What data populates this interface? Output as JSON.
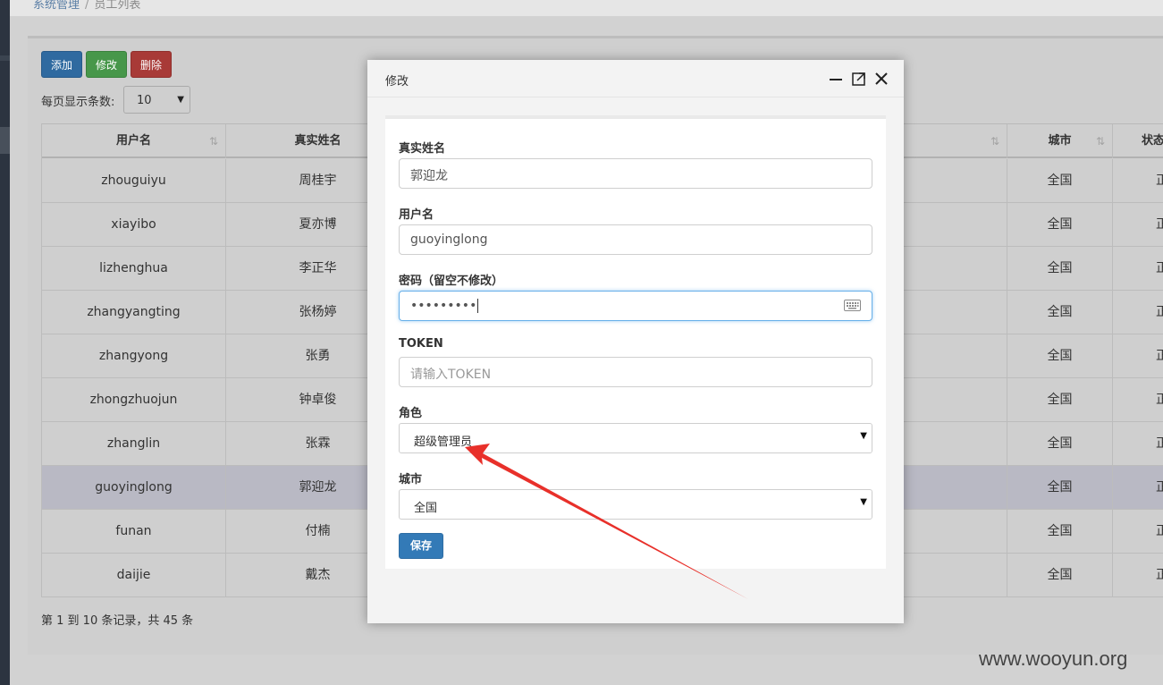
{
  "breadcrumb": {
    "parent": "系统管理",
    "separator": "/",
    "current": "员工列表"
  },
  "toolbar": {
    "add_label": "添加",
    "edit_label": "修改",
    "delete_label": "删除"
  },
  "page_size": {
    "label": "每页显示条数:",
    "value": "10"
  },
  "table": {
    "headers": [
      "用户名",
      "真实姓名",
      "",
      "",
      "城市",
      "状态"
    ],
    "rows": [
      {
        "username": "zhouguiyu",
        "realname": "周桂宇",
        "city": "全国",
        "status": "正"
      },
      {
        "username": "xiayibo",
        "realname": "夏亦博",
        "city": "全国",
        "status": "正"
      },
      {
        "username": "lizhenghua",
        "realname": "李正华",
        "city": "全国",
        "status": "正"
      },
      {
        "username": "zhangyangting",
        "realname": "张杨婷",
        "city": "全国",
        "status": "正"
      },
      {
        "username": "zhangyong",
        "realname": "张勇",
        "city": "全国",
        "status": "正"
      },
      {
        "username": "zhongzhuojun",
        "realname": "钟卓俊",
        "city": "全国",
        "status": "正"
      },
      {
        "username": "zhanglin",
        "realname": "张霖",
        "city": "全国",
        "status": "正"
      },
      {
        "username": "guoyinglong",
        "realname": "郭迎龙",
        "city": "全国",
        "status": "正"
      },
      {
        "username": "funan",
        "realname": "付楠",
        "city": "全国",
        "status": "正"
      },
      {
        "username": "daijie",
        "realname": "戴杰",
        "city": "全国",
        "status": "正"
      }
    ],
    "selected_row": 7
  },
  "summary": "第 1 到 10 条记录，共 45 条",
  "modal": {
    "title": "修改",
    "fields": {
      "realname_label": "真实姓名",
      "realname_value": "郭迎龙",
      "username_label": "用户名",
      "username_value": "guoyinglong",
      "password_label": "密码（留空不修改）",
      "password_value": "•••••••••",
      "token_label": "TOKEN",
      "token_placeholder": "请输入TOKEN",
      "role_label": "角色",
      "role_value": "超级管理员",
      "city_label": "城市",
      "city_value": "全国"
    },
    "save_label": "保存"
  },
  "annotation": {
    "color": "#e8302a"
  },
  "watermark": "www.wooyun.org"
}
